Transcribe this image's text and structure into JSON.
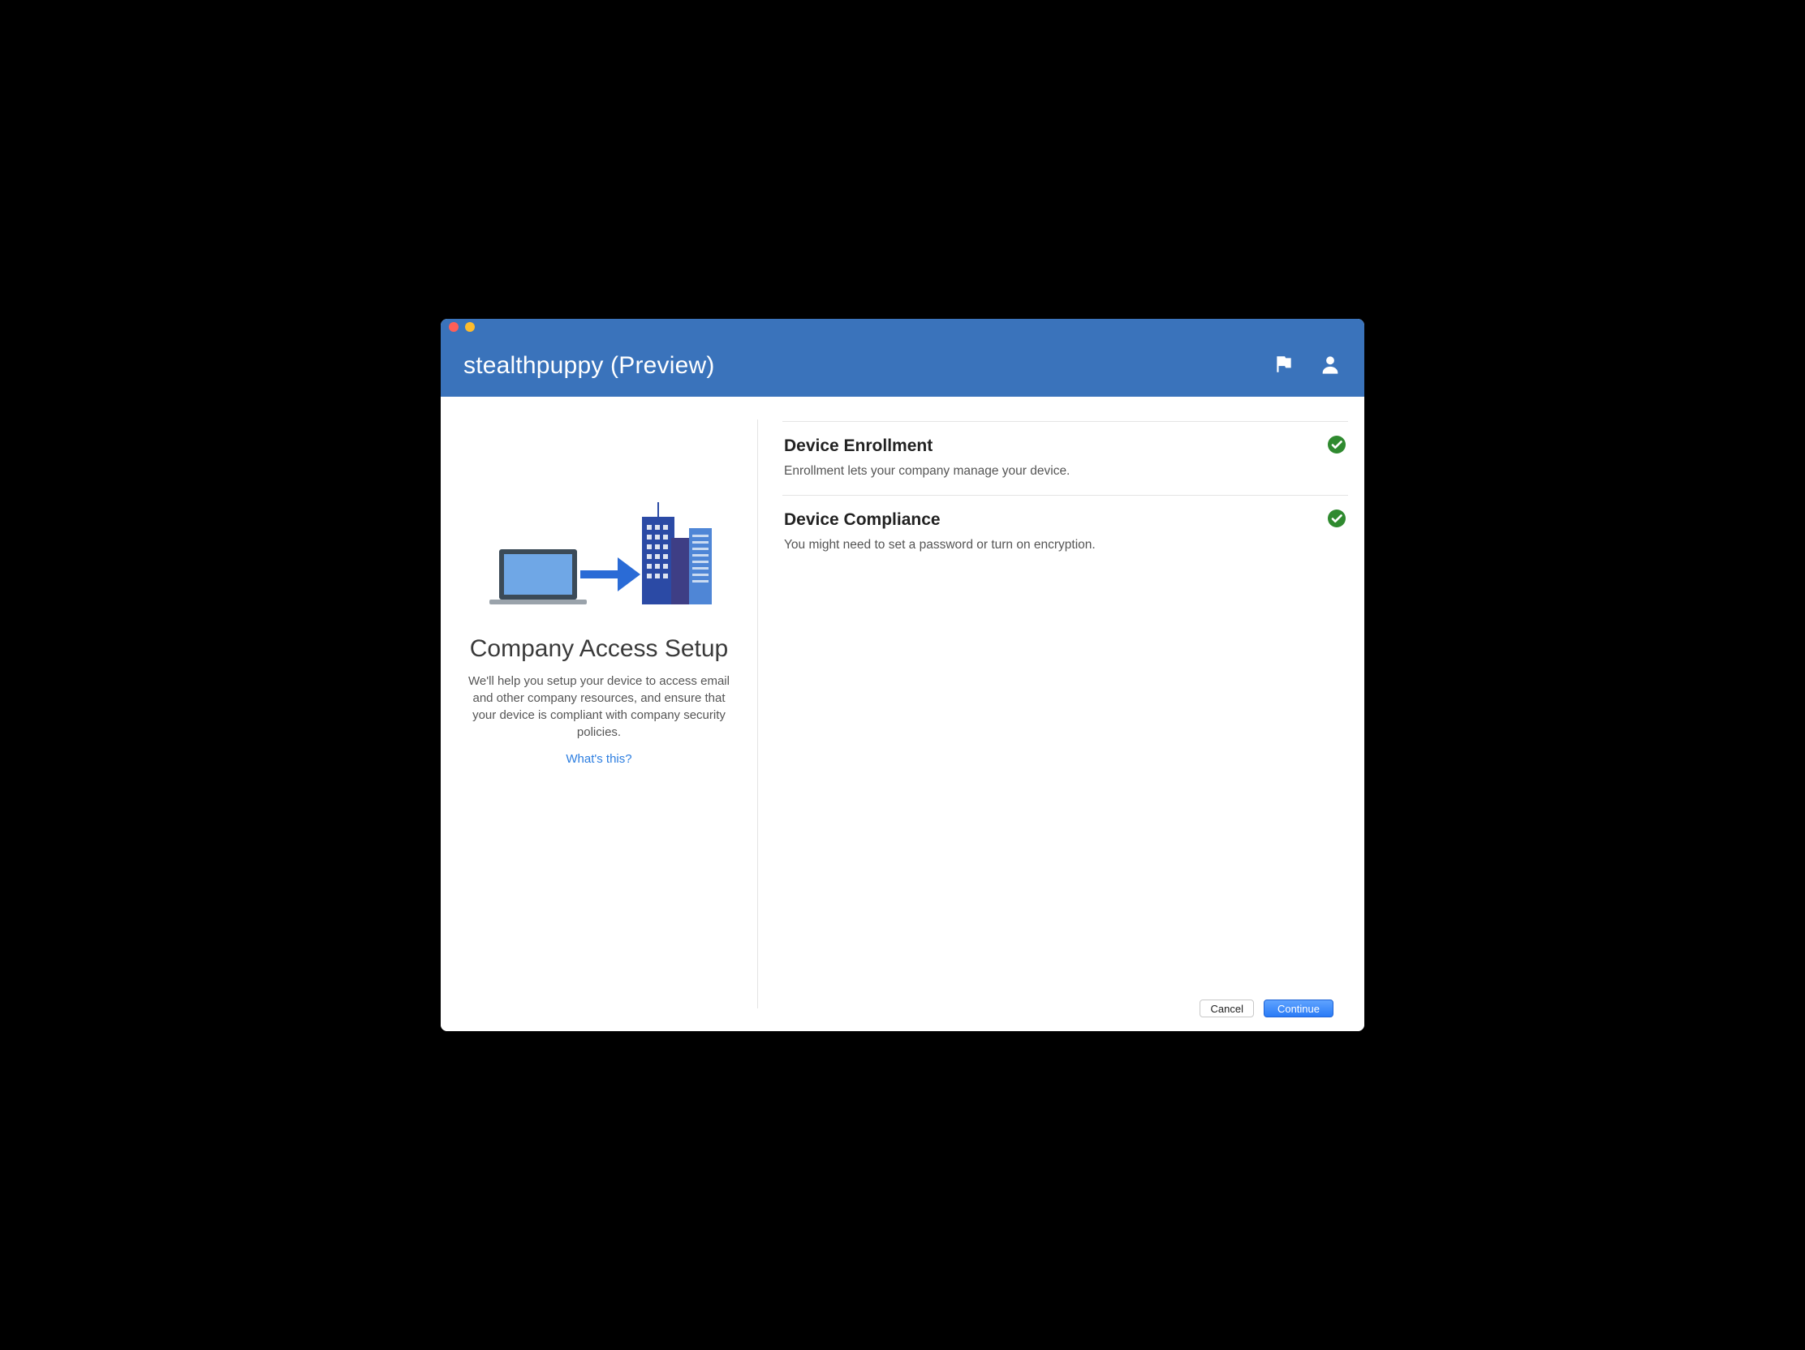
{
  "header": {
    "title": "stealthpuppy (Preview)"
  },
  "left": {
    "title": "Company Access Setup",
    "description": "We'll help you setup your device to access email and other company resources, and ensure that your device is compliant with company security policies.",
    "whats_this": "What's this?"
  },
  "steps": [
    {
      "title": "Device Enrollment",
      "description": "Enrollment lets your company manage your device.",
      "status": "done"
    },
    {
      "title": "Device Compliance",
      "description": "You might need to set a password or turn on encryption.",
      "status": "done"
    }
  ],
  "footer": {
    "cancel": "Cancel",
    "continue": "Continue"
  },
  "colors": {
    "accent": "#3a73bb",
    "success": "#2f8a2f"
  }
}
